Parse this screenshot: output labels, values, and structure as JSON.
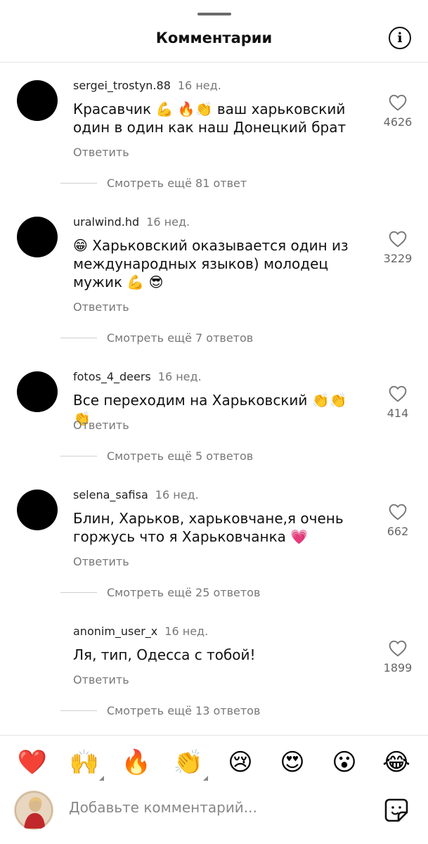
{
  "header": {
    "title": "Комментарии"
  },
  "comments": [
    {
      "username": "sergei_trostyn.88",
      "time": "16 нед.",
      "text": "Красавчик 💪 🔥👏 ваш харьковский один в один как наш Донецкий брат",
      "reply_label": "Ответить",
      "likes": "4626",
      "more_replies": "Смотреть ещё 81 ответ"
    },
    {
      "username": "uralwind.hd",
      "time": "16 нед.",
      "text": "😁 Харьковский оказывается один из международных языков) молодец мужик 💪 😎",
      "reply_label": "Ответить",
      "likes": "3229",
      "more_replies": "Смотреть ещё 7 ответов"
    },
    {
      "username": "fotos_4_deers",
      "time": "16 нед.",
      "text": "Все переходим на Харьковский 👏👏👏",
      "reply_label": "Ответить",
      "likes": "414",
      "more_replies": "Смотреть ещё 5 ответов"
    },
    {
      "username": "selena_safisa",
      "time": "16 нед.",
      "text": "Блин, Харьков, харьковчане,я очень горжусь что я Харьковчанка 💗",
      "reply_label": "Ответить",
      "likes": "662",
      "more_replies": "Смотреть ещё 25 ответов"
    },
    {
      "username": "anonim_user_x",
      "time": "16 нед.",
      "text": "Ля, тип, Одесса с тобой!",
      "reply_label": "Ответить",
      "likes": "1899",
      "more_replies": "Смотреть ещё 13 ответов"
    }
  ],
  "emoji_bar": [
    "❤️",
    "🙌",
    "🔥",
    "👏",
    "😢",
    "😍",
    "😮",
    "😂"
  ],
  "composer": {
    "placeholder": "Добавьте комментарий..."
  },
  "colors": {
    "avatar": "#000000",
    "secondary_text": "#777777",
    "divider": "#e6e6e6"
  },
  "icons": {
    "info": "info-icon",
    "like": "heart-outline-icon",
    "sticker": "sticker-icon"
  }
}
